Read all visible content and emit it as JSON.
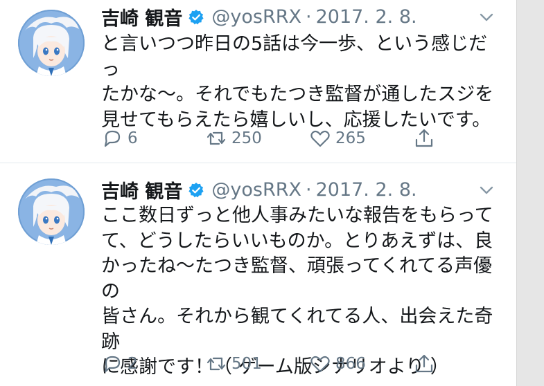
{
  "tweets": [
    {
      "name": "吉崎 観音",
      "handle": "@yosRRX",
      "separator": "·",
      "date": "2017. 2. 8.",
      "text": "と言いつつ昨日の5話は今一歩、という感じだっ\nたかな～。それでもたつき監督が通したスジを\n見せてもらえたら嬉しいし、応援したいです。",
      "replies": "6",
      "retweets": "250",
      "likes": "265"
    },
    {
      "name": "吉崎 観音",
      "handle": "@yosRRX",
      "separator": "·",
      "date": "2017. 2. 8.",
      "text": "ここ数日ずっと他人事みたいな報告をもらって\nて、どうしたらいいものか。とりあえずは、良\nかったね～たつき監督、頑張ってくれてる声優の\n皆さん。それから観てくれてる人、出会えた奇跡\nに感謝です！（ ゲーム版シナリオより ）",
      "replies": "2",
      "retweets": "501",
      "likes": "866"
    }
  ],
  "colors": {
    "accent": "#1da1f2",
    "muted": "#657786",
    "text": "#14171a",
    "divider": "#e1e8ed"
  },
  "icons": [
    "verified-badge-icon",
    "chevron-down-icon",
    "reply-icon",
    "retweet-icon",
    "like-icon",
    "share-icon"
  ]
}
